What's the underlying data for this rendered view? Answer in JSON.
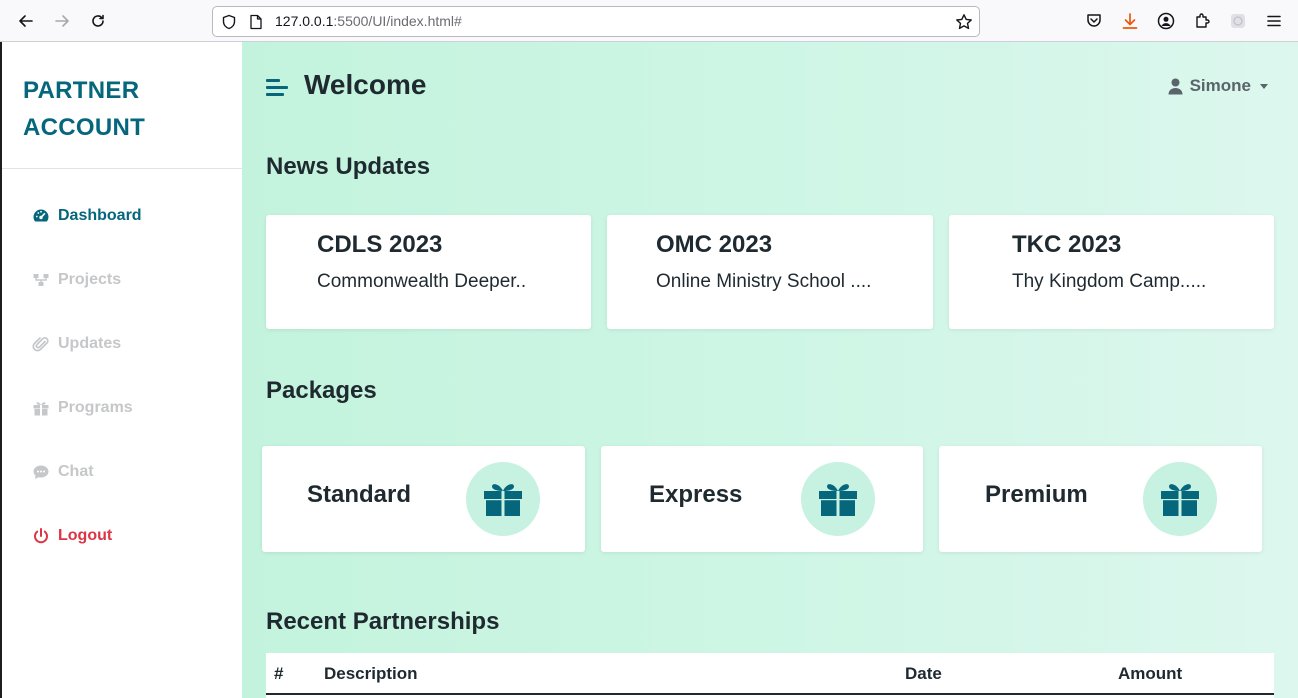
{
  "browser": {
    "url_host": "127.0.0.1",
    "url_rest": ":5500/UI/index.html#"
  },
  "sidebar": {
    "brand_line1": "PARTNER",
    "brand_line2": "ACCOUNT",
    "items": [
      {
        "label": "Dashboard",
        "icon": "gauge-icon",
        "state": "active"
      },
      {
        "label": "Projects",
        "icon": "sitemap-icon",
        "state": "inactive"
      },
      {
        "label": "Updates",
        "icon": "paperclip-icon",
        "state": "inactive"
      },
      {
        "label": "Programs",
        "icon": "gift-icon",
        "state": "inactive"
      },
      {
        "label": "Chat",
        "icon": "chat-icon",
        "state": "inactive"
      },
      {
        "label": "Logout",
        "icon": "power-icon",
        "state": "danger"
      }
    ]
  },
  "header": {
    "title": "Welcome",
    "user_name": "Simone"
  },
  "news": {
    "heading": "News Updates",
    "cards": [
      {
        "title": "CDLS 2023",
        "description": "Commonwealth Deeper.."
      },
      {
        "title": "OMC 2023",
        "description": "Online Ministry School ...."
      },
      {
        "title": "TKC 2023",
        "description": "Thy Kingdom Camp....."
      }
    ]
  },
  "packages": {
    "heading": "Packages",
    "items": [
      {
        "name": "Standard",
        "icon": "gift-icon"
      },
      {
        "name": "Express",
        "icon": "gift-icon"
      },
      {
        "name": "Premium",
        "icon": "gift-icon"
      }
    ]
  },
  "partnerships": {
    "heading": "Recent Partnerships",
    "columns": [
      "#",
      "Description",
      "Date",
      "Amount"
    ]
  },
  "colors": {
    "brand": "#05667c",
    "danger": "#dc3545",
    "inactive": "#c6c7c9",
    "main_bg": "#c3f3dd"
  }
}
